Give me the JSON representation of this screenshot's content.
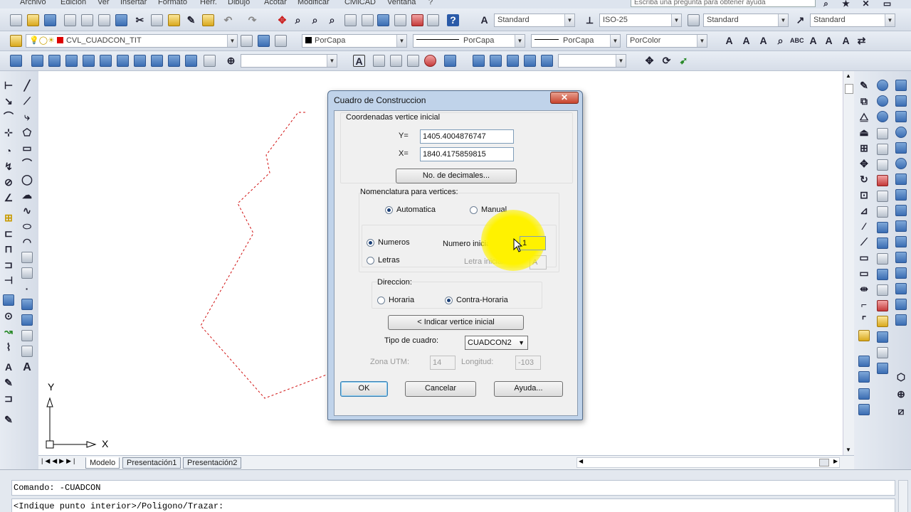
{
  "menu": {
    "items": [
      "Archivo",
      "Edición",
      "Ver",
      "Insertar",
      "Formato",
      "Herr.",
      "Dibujo",
      "Acotar",
      "Modificar",
      "CivilCAD",
      "Ventana",
      "?"
    ],
    "help_placeholder": "Escriba una pregunta para obtener ayuda"
  },
  "styles_toolbar": {
    "text_style": "Standard",
    "dim_style": "ISO-25",
    "table_style": "Standard",
    "multileader_style": "Standard"
  },
  "layers_toolbar": {
    "current_layer": "CVL_CUADCON_TIT",
    "color": "PorCapa",
    "linetype": "PorCapa",
    "lineweight": "PorCapa",
    "plot_style": "PorColor"
  },
  "layout_tabs": [
    "Modelo",
    "Presentación1",
    "Presentación2"
  ],
  "ucs": {
    "x_label": "X",
    "y_label": "Y"
  },
  "command_lines": [
    "Comando: -CUADCON",
    "<Indique punto interior>/Poligono/Trazar:"
  ],
  "dialog": {
    "title": "Cuadro de Construccion",
    "coords_group": "Coordenadas vertice inicial",
    "y_label": "Y=",
    "y_value": "1405.4004876747",
    "x_label": "X=",
    "x_value": "1840.4175859815",
    "decimals_button": "No. de decimales...",
    "nomenclature_group": "Nomenclatura para vertices:",
    "auto_label": "Automatica",
    "manual_label": "Manual",
    "numbers_label": "Numeros",
    "letters_label": "Letras",
    "start_number_label": "Numero inicial:",
    "start_number_value": "1",
    "start_letter_label": "Letra inicial:",
    "start_letter_value": "A",
    "direction_group": "Direccion:",
    "clockwise_label": "Horaria",
    "counter_label": "Contra-Horaria",
    "pick_button": "< Indicar vertice inicial",
    "table_type_label": "Tipo de cuadro:",
    "table_type_value": "CUADCON2",
    "utm_zone_label": "Zona UTM:",
    "utm_zone_value": "14",
    "longitude_label": "Longitud:",
    "longitude_value": "-103",
    "ok_button": "OK",
    "cancel_button": "Cancelar",
    "help_button": "Ayuda...",
    "close_glyph": "✕"
  }
}
